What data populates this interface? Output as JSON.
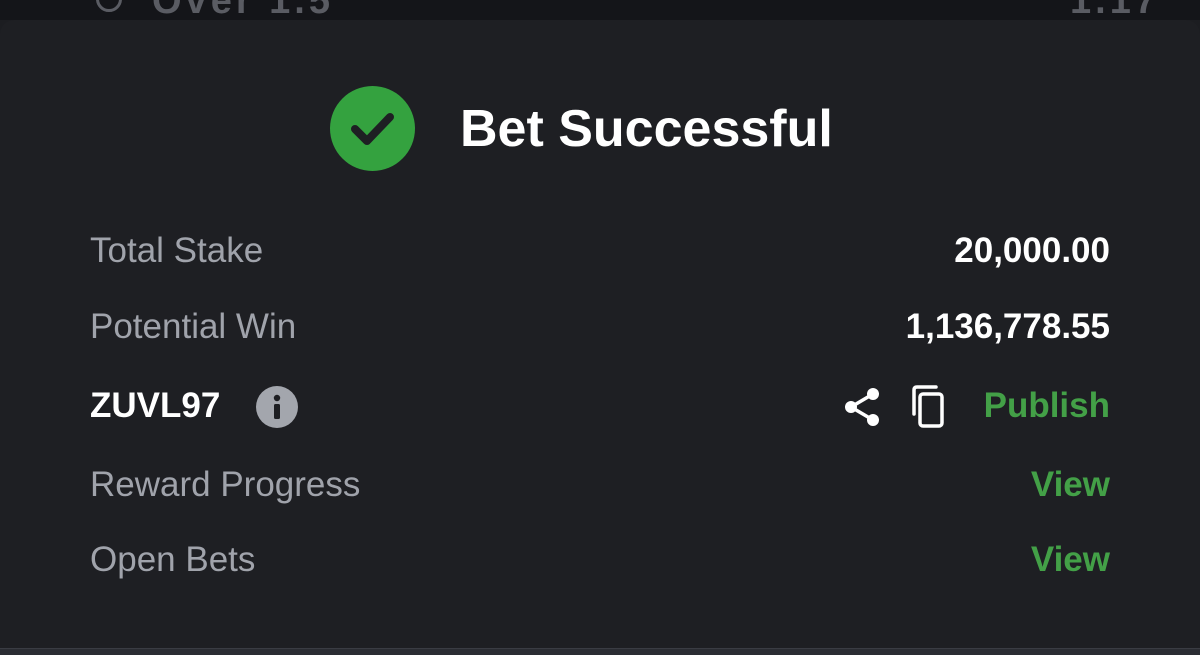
{
  "top_strip": {
    "partial_text_left": "Over 1.5",
    "partial_text_right": "1.17"
  },
  "header": {
    "title": "Bet Successful",
    "status_icon": "check-circle-icon",
    "accent_color": "#34a23f"
  },
  "summary": {
    "total_stake": {
      "label": "Total Stake",
      "value": "20,000.00"
    },
    "potential_win": {
      "label": "Potential Win",
      "value": "1,136,778.55"
    }
  },
  "booking": {
    "code": "ZUVL97",
    "info_icon": "info-icon",
    "share_icon": "share-icon",
    "copy_icon": "copy-icon",
    "publish_label": "Publish"
  },
  "links": {
    "reward_progress": {
      "label": "Reward Progress",
      "action": "View"
    },
    "open_bets": {
      "label": "Open Bets",
      "action": "View"
    }
  }
}
